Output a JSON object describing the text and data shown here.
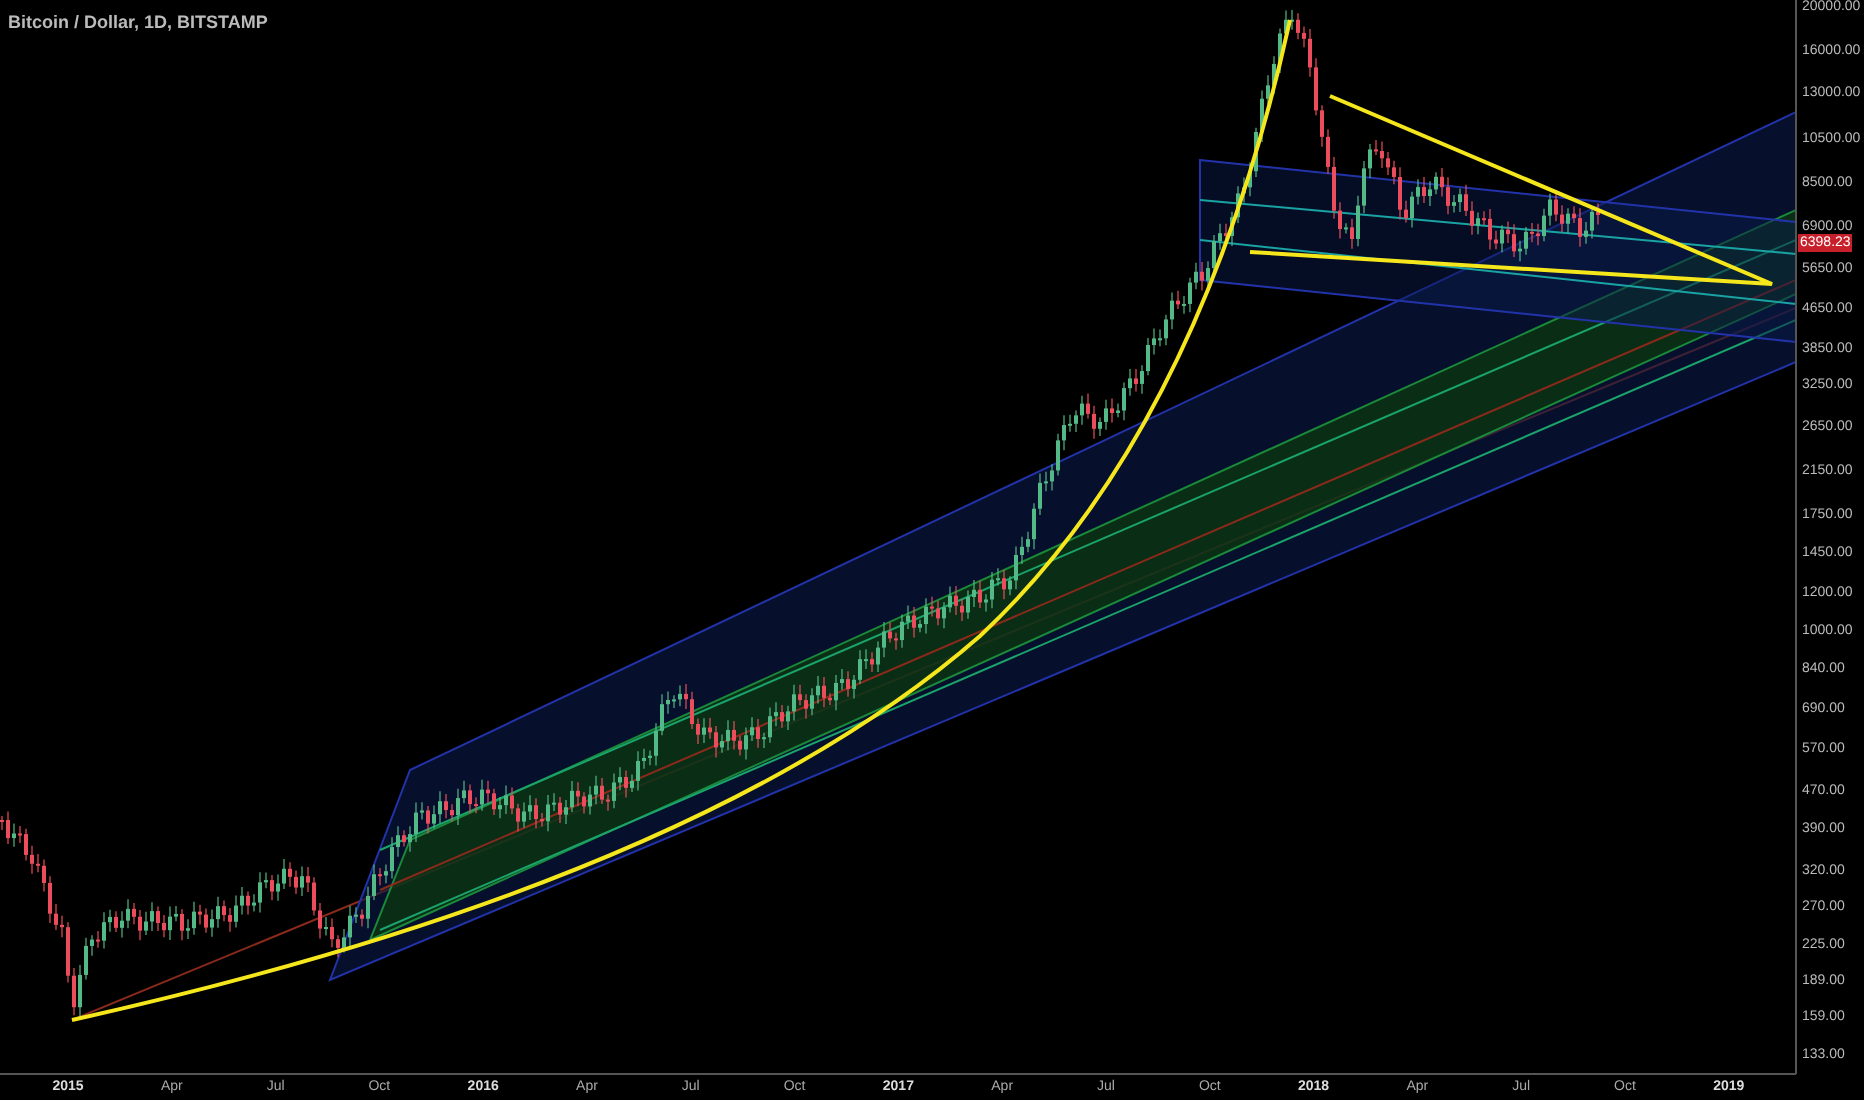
{
  "title": "Bitcoin / Dollar, 1D, BITSTAMP",
  "price_axis": [
    "20000.00",
    "16000.00",
    "13000.00",
    "10500.00",
    "8500.00",
    "6900.00",
    "5650.00",
    "4650.00",
    "3850.00",
    "3250.00",
    "2650.00",
    "2150.00",
    "1750.00",
    "1450.00",
    "1200.00",
    "1000.00",
    "840.00",
    "690.00",
    "570.00",
    "470.00",
    "390.00",
    "320.00",
    "270.00",
    "225.00",
    "189.00",
    "159.00",
    "133.00"
  ],
  "last_price": "6398.23",
  "time_axis": [
    {
      "label": "2015",
      "kind": "year"
    },
    {
      "label": "Apr",
      "kind": "month"
    },
    {
      "label": "Jul",
      "kind": "month"
    },
    {
      "label": "Oct",
      "kind": "month"
    },
    {
      "label": "2016",
      "kind": "year"
    },
    {
      "label": "Apr",
      "kind": "month"
    },
    {
      "label": "Jul",
      "kind": "month"
    },
    {
      "label": "Oct",
      "kind": "month"
    },
    {
      "label": "2017",
      "kind": "year"
    },
    {
      "label": "Apr",
      "kind": "month"
    },
    {
      "label": "Jul",
      "kind": "month"
    },
    {
      "label": "Oct",
      "kind": "month"
    },
    {
      "label": "2018",
      "kind": "year"
    },
    {
      "label": "Apr",
      "kind": "month"
    },
    {
      "label": "Jul",
      "kind": "month"
    },
    {
      "label": "Oct",
      "kind": "month"
    },
    {
      "label": "2019",
      "kind": "year"
    }
  ]
}
